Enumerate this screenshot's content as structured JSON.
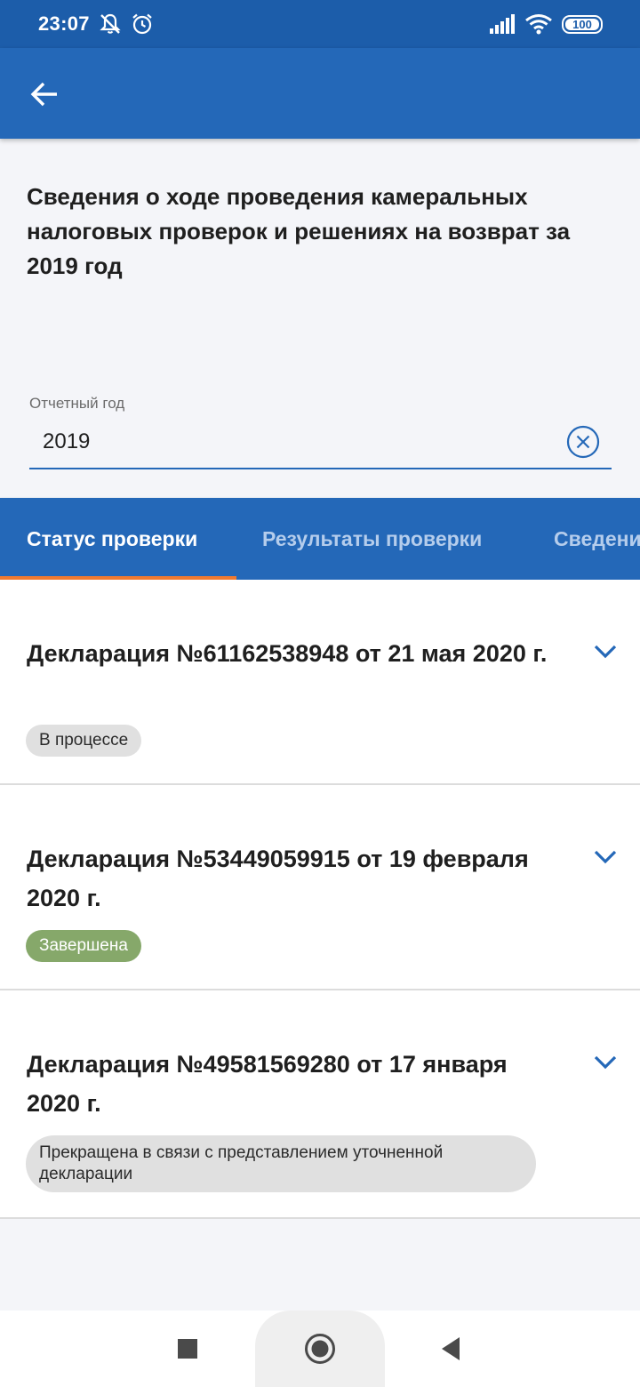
{
  "status_bar": {
    "time": "23:07",
    "battery": "100",
    "icons": [
      "notifications-off-icon",
      "alarm-icon",
      "signal-icon",
      "wifi-icon",
      "battery-icon"
    ]
  },
  "app_bar": {
    "back_icon": "arrow-left-icon"
  },
  "page": {
    "title": "Сведения о ходе проведения камеральных налоговых проверок и решениях на возврат за 2019 год"
  },
  "year_field": {
    "label": "Отчетный год",
    "value": "2019",
    "clear_icon": "clear-circle-icon"
  },
  "tabs": [
    {
      "label": "Статус проверки",
      "active": true
    },
    {
      "label": "Результаты проверки",
      "active": false
    },
    {
      "label": "Сведения",
      "active": false
    }
  ],
  "declarations": [
    {
      "title": "Декларация №61162538948 от 21 мая 2020 г.",
      "status": "В процессе",
      "status_type": "grey"
    },
    {
      "title": "Декларация №53449059915 от 19 февраля 2020 г.",
      "status": "Завершена",
      "status_type": "green"
    },
    {
      "title": "Декларация №49581569280 от 17 января 2020 г.",
      "status": "Прекращена в связи с представлением уточненной декларации",
      "status_type": "grey"
    }
  ],
  "colors": {
    "primary": "#2468b8",
    "status_bar": "#1c5daa",
    "tab_indicator": "#f07a30",
    "badge_green": "#86a86a",
    "badge_grey": "#e0e0e0"
  },
  "nav_bar": {
    "icons": [
      "recents-square-icon",
      "home-circle-icon",
      "back-triangle-icon"
    ]
  }
}
